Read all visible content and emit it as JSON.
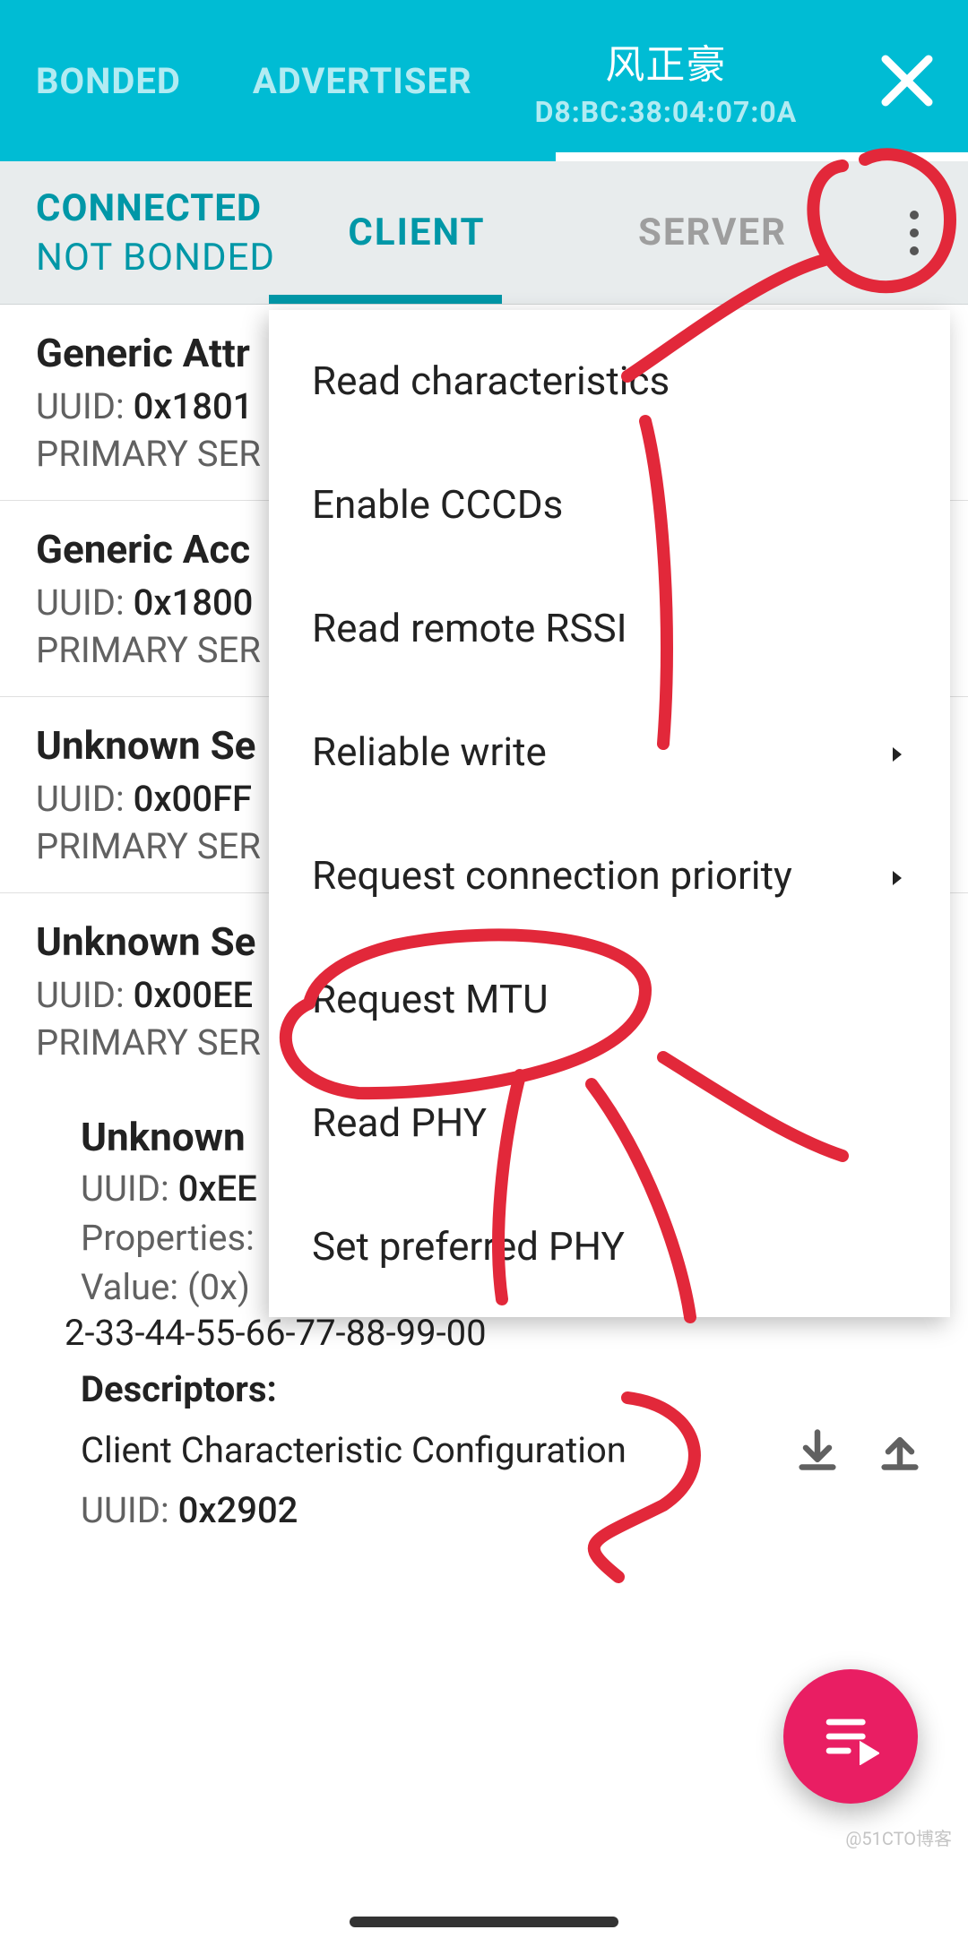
{
  "topTabs": {
    "bonded": "BONDED",
    "advertiser": "ADVERTISER",
    "device": {
      "name": "风正豪",
      "mac": "D8:BC:38:04:07:0A"
    }
  },
  "status": {
    "main": "CONNECTED",
    "sub": "NOT BONDED"
  },
  "subTabs": {
    "client": "CLIENT",
    "server": "SERVER"
  },
  "services": [
    {
      "name": "Generic Attr",
      "uuidLabel": "UUID: ",
      "uuid": "0x1801",
      "type": "PRIMARY SER"
    },
    {
      "name": "Generic Acc",
      "uuidLabel": "UUID: ",
      "uuid": "0x1800",
      "type": "PRIMARY SER"
    },
    {
      "name": "Unknown Se",
      "uuidLabel": "UUID: ",
      "uuid": "0x00FF",
      "type": "PRIMARY SER"
    },
    {
      "name": "Unknown Se",
      "uuidLabel": "UUID: ",
      "uuid": "0x00EE",
      "type": "PRIMARY SER"
    }
  ],
  "characteristic": {
    "name": "Unknown",
    "uuidLabel": "UUID: ",
    "uuid": "0xEE",
    "propsLabel": "Properties:",
    "valueLabel": "Value: ",
    "valueHex": "(0x)",
    "valueCont": "2-33-44-55-66-77-88-99-00",
    "descHeading": "Descriptors:",
    "descName": "Client Characteristic Configuration",
    "descUuidLabel": "UUID: ",
    "descUuid": "0x2902"
  },
  "menu": {
    "items": [
      {
        "label": "Read characteristics",
        "sub": false
      },
      {
        "label": "Enable CCCDs",
        "sub": false
      },
      {
        "label": "Read remote RSSI",
        "sub": false
      },
      {
        "label": "Reliable write",
        "sub": true
      },
      {
        "label": "Request connection priority",
        "sub": true
      },
      {
        "label": "Request MTU",
        "sub": false
      },
      {
        "label": "Read PHY",
        "sub": false
      },
      {
        "label": "Set preferred PHY",
        "sub": false
      }
    ]
  },
  "watermark": "@51CTO博客"
}
